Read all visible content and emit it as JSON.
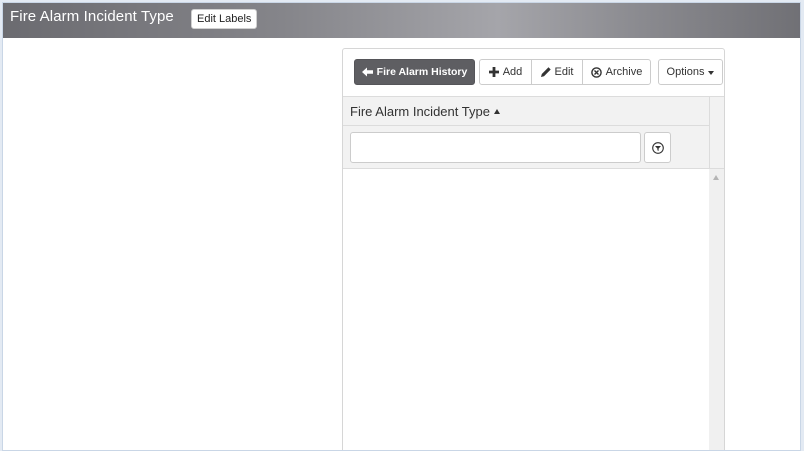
{
  "header": {
    "title": "Fire Alarm Incident Type",
    "edit_labels": "Edit Labels"
  },
  "toolbar": {
    "history_label": "Fire Alarm History",
    "add_label": "Add",
    "edit_label": "Edit",
    "archive_label": "Archive",
    "options_label": "Options"
  },
  "grid": {
    "column_header": "Fire Alarm Incident Type",
    "sort": "ascending",
    "filter_value": "",
    "rows": []
  },
  "icons": {
    "history": "arrow-left-icon",
    "add": "plus-icon",
    "edit": "pencil-icon",
    "archive": "circle-x-icon",
    "options": "caret-down-icon",
    "filter": "funnel-icon",
    "sort": "sort-up-icon"
  },
  "colors": {
    "history_button": "#5e5e62",
    "header_bar": "#85858a"
  }
}
